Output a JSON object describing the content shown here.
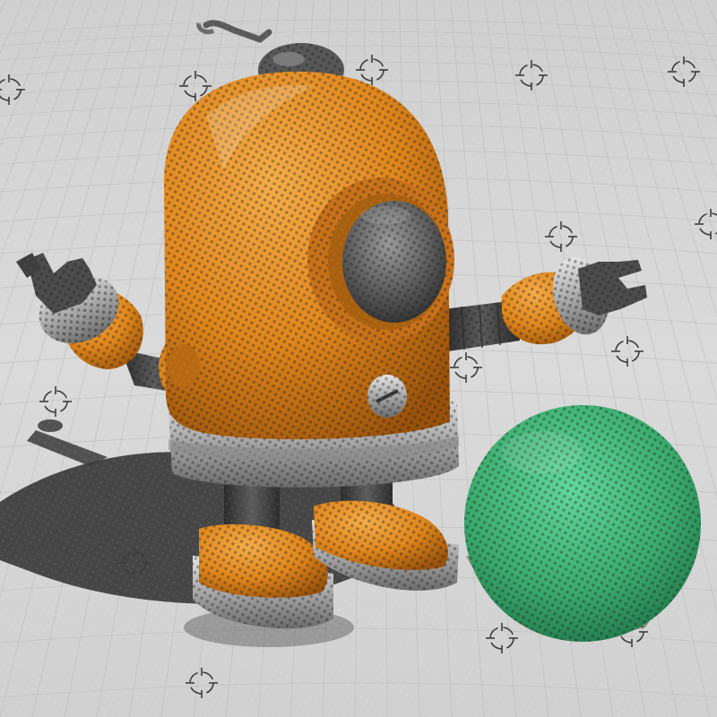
{
  "scene": {
    "subject": "robot-with-ball",
    "colors": {
      "background": "#d4d4d4",
      "floor_light": "#e2e2e2",
      "grid_line": "#b9b9b9",
      "target_mark": "#3a3a3a",
      "robot_orange": "#e08a1e",
      "robot_orange_dark": "#a65a0c",
      "robot_orange_light": "#f2ae4a",
      "metal_dark": "#4a4a4a",
      "metal_mid": "#6f6f6f",
      "metal_light": "#bdbdbd",
      "rim_light": "#e8e8e8",
      "ball_green": "#3fae72",
      "ball_green_light": "#5fd394",
      "ball_green_dark": "#1f7a4c",
      "shadow": "#3b3b3b"
    },
    "icons": {
      "floor_marker": "crosshair-target-icon"
    }
  }
}
